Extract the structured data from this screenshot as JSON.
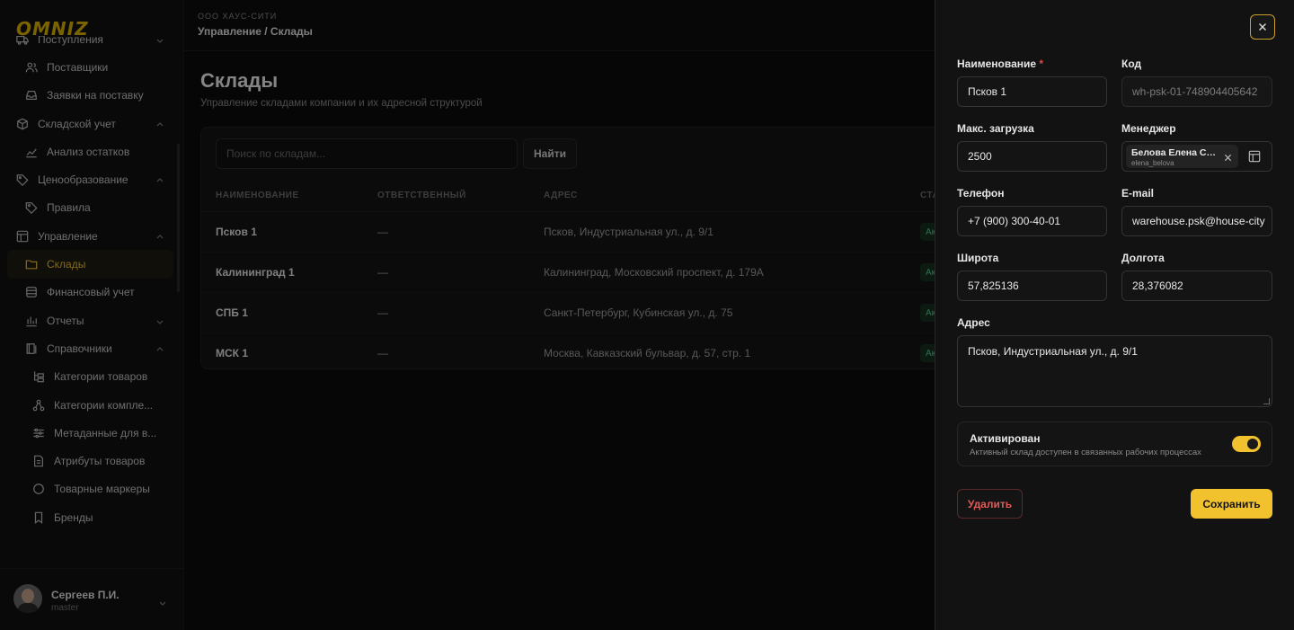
{
  "brand": {
    "logo": "OMNIZ",
    "accent": "#f2c12e"
  },
  "sidebar": {
    "items": [
      {
        "label": "Поступления",
        "icon": "truck-icon",
        "level": "group",
        "chevron": "down"
      },
      {
        "label": "Поставщики",
        "icon": "users-icon",
        "level": "sub"
      },
      {
        "label": "Заявки на поставку",
        "icon": "inbox-icon",
        "level": "sub"
      },
      {
        "label": "Складской учет",
        "icon": "box-icon",
        "level": "group",
        "chevron": "up"
      },
      {
        "label": "Анализ остатков",
        "icon": "chart-icon",
        "level": "sub"
      },
      {
        "label": "Ценообразование",
        "icon": "tag-icon",
        "level": "group",
        "chevron": "up"
      },
      {
        "label": "Правила",
        "icon": "tag-icon",
        "level": "sub"
      },
      {
        "label": "Управление",
        "icon": "layout-icon",
        "level": "group",
        "chevron": "up"
      },
      {
        "label": "Склады",
        "icon": "folder-icon",
        "level": "sub",
        "active": true
      },
      {
        "label": "Финансовый учет",
        "icon": "database-icon",
        "level": "sub"
      },
      {
        "label": "Отчеты",
        "icon": "bar-chart-icon",
        "level": "sub",
        "chevron": "down"
      },
      {
        "label": "Справочники",
        "icon": "book-icon",
        "level": "sub",
        "chevron": "up"
      },
      {
        "label": "Категории товаров",
        "icon": "hierarchy-icon",
        "level": "sub2"
      },
      {
        "label": "Категории компле...",
        "icon": "network-icon",
        "level": "sub2"
      },
      {
        "label": "Метаданные для в...",
        "icon": "sliders-icon",
        "level": "sub2"
      },
      {
        "label": "Атрибуты товаров",
        "icon": "document-icon",
        "level": "sub2"
      },
      {
        "label": "Товарные маркеры",
        "icon": "circle-icon",
        "level": "sub2"
      },
      {
        "label": "Бренды",
        "icon": "bookmark-icon",
        "level": "sub2"
      }
    ]
  },
  "user": {
    "name": "Сергеев П.И.",
    "role": "master"
  },
  "topbar": {
    "company": "ООО ХАУС-СИТИ",
    "breadcrumb": "Управление / Склады"
  },
  "page": {
    "title": "Склады",
    "subtitle": "Управление складами компании и их адресной структурой",
    "search_placeholder": "Поиск по складам...",
    "find_label": "Найти"
  },
  "table": {
    "columns": [
      "НАИМЕНОВАНИЕ",
      "ОТВЕТСТВЕННЫЙ",
      "АДРЕС",
      "СТА"
    ],
    "rows": [
      {
        "name": "Псков 1",
        "responsible": "—",
        "address": "Псков, Индустриальная ул., д. 9/1",
        "status": "Ак"
      },
      {
        "name": "Калининград 1",
        "responsible": "—",
        "address": "Калининград, Московский проспект, д. 179А",
        "status": "Ак"
      },
      {
        "name": "СПБ 1",
        "responsible": "—",
        "address": "Санкт-Петербург, Кубинская ул., д. 75",
        "status": "Ак"
      },
      {
        "name": "МСК 1",
        "responsible": "—",
        "address": "Москва, Кавказский бульвар, д. 57, стр. 1",
        "status": "Ак"
      }
    ]
  },
  "drawer": {
    "name_label": "Наименование",
    "required_mark": "*",
    "name_value": "Псков 1",
    "code_label": "Код",
    "code_value": "wh-psk-01-748904405642",
    "max_load_label": "Макс. загрузка",
    "max_load_value": "2500",
    "manager_label": "Менеджер",
    "manager_name": "Белова Елена Сер...",
    "manager_login": "elena_belova",
    "phone_label": "Телефон",
    "phone_value": "+7 (900) 300-40-01",
    "email_label": "E-mail",
    "email_value": "warehouse.psk@house-city",
    "lat_label": "Широта",
    "lat_value": "57,825136",
    "lon_label": "Долгота",
    "lon_value": "28,376082",
    "address_label": "Адрес",
    "address_value": "Псков, Индустриальная ул., д. 9/1",
    "active_title": "Активирован",
    "active_desc": "Активный склад доступен в связанных рабочих процессах",
    "active": true,
    "delete_label": "Удалить",
    "save_label": "Сохранить"
  }
}
